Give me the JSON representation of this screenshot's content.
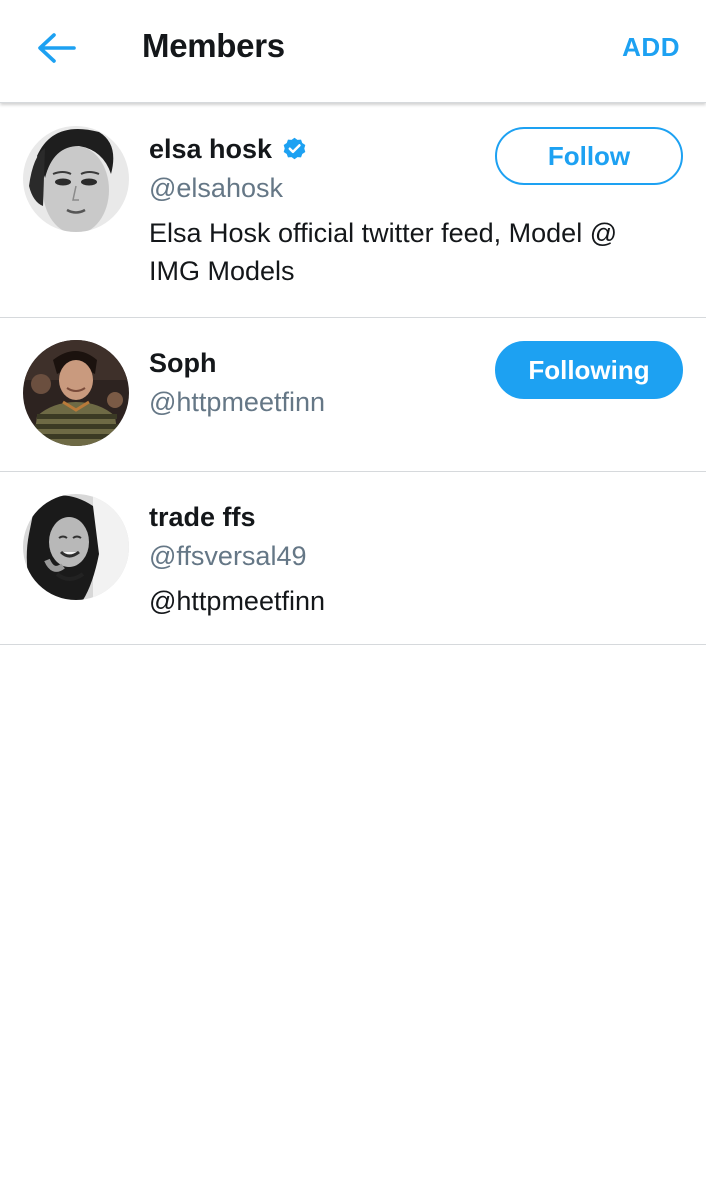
{
  "header": {
    "title": "Members",
    "add_label": "ADD",
    "back_icon": "arrow-left-icon"
  },
  "colors": {
    "accent": "#1da1f2",
    "text_primary": "#14171a",
    "text_secondary": "#657786",
    "divider": "#d6d9dc"
  },
  "members": [
    {
      "name": "elsa hosk",
      "verified": true,
      "handle": "@elsahosk",
      "bio": "Elsa Hosk official twitter feed, Model @ IMG Models",
      "button_label": "Follow",
      "button_state": "follow"
    },
    {
      "name": "Soph",
      "verified": false,
      "handle": "@httpmeetfinn",
      "bio": "",
      "button_label": "Following",
      "button_state": "following"
    },
    {
      "name": "trade ffs",
      "verified": false,
      "handle": "@ffsversal49",
      "bio": "@httpmeetfinn"
    }
  ]
}
